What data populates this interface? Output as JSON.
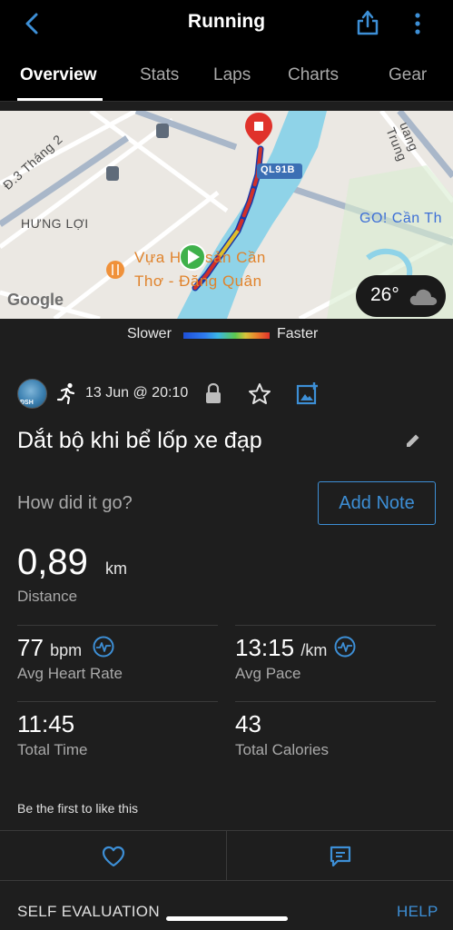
{
  "header": {
    "title": "Running",
    "back_icon": "chevron-left-icon",
    "share_icon": "share-icon",
    "more_icon": "more-vertical-icon"
  },
  "tabs": [
    {
      "label": "Overview",
      "active": true
    },
    {
      "label": "Stats",
      "active": false
    },
    {
      "label": "Laps",
      "active": false
    },
    {
      "label": "Charts",
      "active": false
    },
    {
      "label": "Gear",
      "active": false
    }
  ],
  "map": {
    "labels": {
      "street_1": "Đ.3 Tháng 2",
      "district": "HƯNG LỢI",
      "road_badge": "QL91B",
      "store": "GO! Cần Th",
      "street_2": "uang Trung",
      "restaurant_line1": "Vựa H",
      "restaurant_line1b": "sản Cần",
      "restaurant_line2": "Thơ - Đăng Quân"
    },
    "google_logo": "Google",
    "weather": {
      "temperature": "26°",
      "icon": "cloud-icon"
    }
  },
  "pace_legend": {
    "slower": "Slower",
    "faster": "Faster"
  },
  "activity": {
    "avatar_initials": "ĐSH",
    "activity_type_icon": "running-icon",
    "date": "13 Jun @ 20:10",
    "title": "Dắt bộ khi bể lốp xe đạp",
    "prompt": "How did it go?",
    "add_note_label": "Add Note"
  },
  "stats": {
    "distance": {
      "value": "0,89",
      "unit": "km",
      "label": "Distance"
    },
    "heart_rate": {
      "value": "77",
      "unit": "bpm",
      "label": "Avg Heart Rate"
    },
    "pace": {
      "value": "13:15",
      "unit": "/km",
      "label": "Avg Pace"
    },
    "time": {
      "value": "11:45",
      "label": "Total Time"
    },
    "calories": {
      "value": "43",
      "label": "Total Calories"
    }
  },
  "social": {
    "like_prompt": "Be the first to like this"
  },
  "footer": {
    "self_evaluation": "SELF EVALUATION",
    "help": "HELP"
  },
  "colors": {
    "accent": "#3d8fd6",
    "background": "#1e1e1e",
    "bar": "#000000"
  }
}
